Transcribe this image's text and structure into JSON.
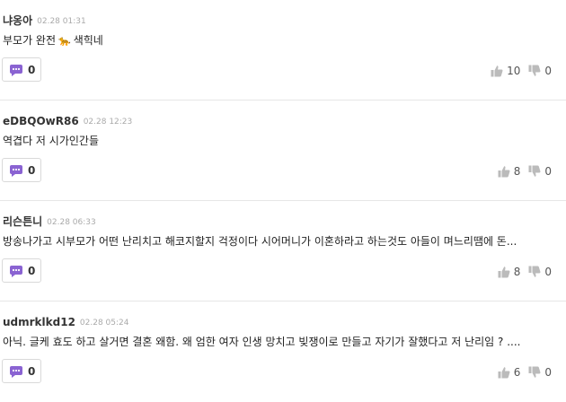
{
  "comments": [
    {
      "author": "냐옹아",
      "time": "02.28 01:31",
      "text_before": "부모가 완전",
      "emoji": "🐆",
      "text_after": "색힉네",
      "replies": "0",
      "likes": "10",
      "dislikes": "0"
    },
    {
      "author": "eDBQOwR86",
      "time": "02.28 12:23",
      "text": "역겹다 저 시가인간들",
      "replies": "0",
      "likes": "8",
      "dislikes": "0"
    },
    {
      "author": "리슨튼니",
      "time": "02.28 06:33",
      "text": "방송나가고 시부모가 어떤 난리치고 해코지할지 걱정이다 시어머니가 이혼하라고 하는것도 아들이 며느리땜에 돈...",
      "replies": "0",
      "likes": "8",
      "dislikes": "0"
    },
    {
      "author": "udmrklkd12",
      "time": "02.28 05:24",
      "text": "아닉. 글케 효도 하고 살거면 결혼 왜함. 왜 엄한 여자 인생 망치고 빚쟁이로 만들고 자기가 잘했다고 저 난리임 ? ....",
      "replies": "0",
      "likes": "6",
      "dislikes": "0"
    }
  ],
  "icons": {
    "reply": "speech-bubble-icon",
    "like": "thumbs-up-icon",
    "dislike": "thumbs-down-icon"
  },
  "colors": {
    "reply_icon": "#8a63d2",
    "vote_icon": "#bbbbbb",
    "divider": "#e6e6e6"
  }
}
